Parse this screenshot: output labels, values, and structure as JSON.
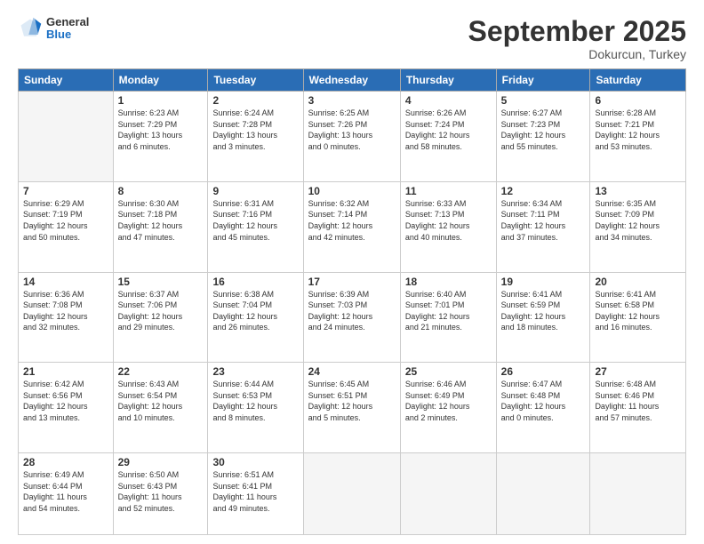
{
  "header": {
    "logo": {
      "general": "General",
      "blue": "Blue"
    },
    "title": "September 2025",
    "subtitle": "Dokurcun, Turkey"
  },
  "columns": [
    "Sunday",
    "Monday",
    "Tuesday",
    "Wednesday",
    "Thursday",
    "Friday",
    "Saturday"
  ],
  "weeks": [
    [
      {
        "day": "",
        "info": ""
      },
      {
        "day": "1",
        "info": "Sunrise: 6:23 AM\nSunset: 7:29 PM\nDaylight: 13 hours\nand 6 minutes."
      },
      {
        "day": "2",
        "info": "Sunrise: 6:24 AM\nSunset: 7:28 PM\nDaylight: 13 hours\nand 3 minutes."
      },
      {
        "day": "3",
        "info": "Sunrise: 6:25 AM\nSunset: 7:26 PM\nDaylight: 13 hours\nand 0 minutes."
      },
      {
        "day": "4",
        "info": "Sunrise: 6:26 AM\nSunset: 7:24 PM\nDaylight: 12 hours\nand 58 minutes."
      },
      {
        "day": "5",
        "info": "Sunrise: 6:27 AM\nSunset: 7:23 PM\nDaylight: 12 hours\nand 55 minutes."
      },
      {
        "day": "6",
        "info": "Sunrise: 6:28 AM\nSunset: 7:21 PM\nDaylight: 12 hours\nand 53 minutes."
      }
    ],
    [
      {
        "day": "7",
        "info": "Sunrise: 6:29 AM\nSunset: 7:19 PM\nDaylight: 12 hours\nand 50 minutes."
      },
      {
        "day": "8",
        "info": "Sunrise: 6:30 AM\nSunset: 7:18 PM\nDaylight: 12 hours\nand 47 minutes."
      },
      {
        "day": "9",
        "info": "Sunrise: 6:31 AM\nSunset: 7:16 PM\nDaylight: 12 hours\nand 45 minutes."
      },
      {
        "day": "10",
        "info": "Sunrise: 6:32 AM\nSunset: 7:14 PM\nDaylight: 12 hours\nand 42 minutes."
      },
      {
        "day": "11",
        "info": "Sunrise: 6:33 AM\nSunset: 7:13 PM\nDaylight: 12 hours\nand 40 minutes."
      },
      {
        "day": "12",
        "info": "Sunrise: 6:34 AM\nSunset: 7:11 PM\nDaylight: 12 hours\nand 37 minutes."
      },
      {
        "day": "13",
        "info": "Sunrise: 6:35 AM\nSunset: 7:09 PM\nDaylight: 12 hours\nand 34 minutes."
      }
    ],
    [
      {
        "day": "14",
        "info": "Sunrise: 6:36 AM\nSunset: 7:08 PM\nDaylight: 12 hours\nand 32 minutes."
      },
      {
        "day": "15",
        "info": "Sunrise: 6:37 AM\nSunset: 7:06 PM\nDaylight: 12 hours\nand 29 minutes."
      },
      {
        "day": "16",
        "info": "Sunrise: 6:38 AM\nSunset: 7:04 PM\nDaylight: 12 hours\nand 26 minutes."
      },
      {
        "day": "17",
        "info": "Sunrise: 6:39 AM\nSunset: 7:03 PM\nDaylight: 12 hours\nand 24 minutes."
      },
      {
        "day": "18",
        "info": "Sunrise: 6:40 AM\nSunset: 7:01 PM\nDaylight: 12 hours\nand 21 minutes."
      },
      {
        "day": "19",
        "info": "Sunrise: 6:41 AM\nSunset: 6:59 PM\nDaylight: 12 hours\nand 18 minutes."
      },
      {
        "day": "20",
        "info": "Sunrise: 6:41 AM\nSunset: 6:58 PM\nDaylight: 12 hours\nand 16 minutes."
      }
    ],
    [
      {
        "day": "21",
        "info": "Sunrise: 6:42 AM\nSunset: 6:56 PM\nDaylight: 12 hours\nand 13 minutes."
      },
      {
        "day": "22",
        "info": "Sunrise: 6:43 AM\nSunset: 6:54 PM\nDaylight: 12 hours\nand 10 minutes."
      },
      {
        "day": "23",
        "info": "Sunrise: 6:44 AM\nSunset: 6:53 PM\nDaylight: 12 hours\nand 8 minutes."
      },
      {
        "day": "24",
        "info": "Sunrise: 6:45 AM\nSunset: 6:51 PM\nDaylight: 12 hours\nand 5 minutes."
      },
      {
        "day": "25",
        "info": "Sunrise: 6:46 AM\nSunset: 6:49 PM\nDaylight: 12 hours\nand 2 minutes."
      },
      {
        "day": "26",
        "info": "Sunrise: 6:47 AM\nSunset: 6:48 PM\nDaylight: 12 hours\nand 0 minutes."
      },
      {
        "day": "27",
        "info": "Sunrise: 6:48 AM\nSunset: 6:46 PM\nDaylight: 11 hours\nand 57 minutes."
      }
    ],
    [
      {
        "day": "28",
        "info": "Sunrise: 6:49 AM\nSunset: 6:44 PM\nDaylight: 11 hours\nand 54 minutes."
      },
      {
        "day": "29",
        "info": "Sunrise: 6:50 AM\nSunset: 6:43 PM\nDaylight: 11 hours\nand 52 minutes."
      },
      {
        "day": "30",
        "info": "Sunrise: 6:51 AM\nSunset: 6:41 PM\nDaylight: 11 hours\nand 49 minutes."
      },
      {
        "day": "",
        "info": ""
      },
      {
        "day": "",
        "info": ""
      },
      {
        "day": "",
        "info": ""
      },
      {
        "day": "",
        "info": ""
      }
    ]
  ]
}
